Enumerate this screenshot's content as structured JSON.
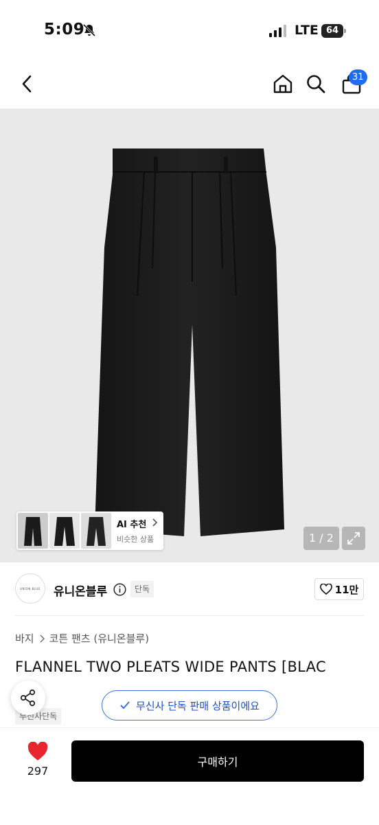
{
  "status_bar": {
    "time": "5:09",
    "network": "LTE",
    "battery": "64"
  },
  "header": {
    "cart_count": "31",
    "icons": [
      "back-icon",
      "home-icon",
      "search-icon",
      "cart-icon"
    ]
  },
  "gallery": {
    "ai_title": "AI 추천",
    "ai_subtitle": "비슷한 상품",
    "page_indicator": "1 / 2",
    "product_color": "#1a1a1a",
    "background_color": "#e9e9e9"
  },
  "brand": {
    "logo_text": "UNION BLUE",
    "name": "유니온블루",
    "tag": "단독",
    "likes": "11만"
  },
  "product": {
    "breadcrumb": [
      "바지",
      "코튼 팬츠 (유니온블루)"
    ],
    "title": "FLANNEL TWO PLEATS WIDE PANTS [BLAC",
    "store_tag": "무신사단독",
    "exclusive_notice": "무신사 단독 판매 상품이에요"
  },
  "bottom_bar": {
    "wish_count": "297",
    "buy_label": "구매하기",
    "heart_color": "#e8242e",
    "accent_color": "#1e6cf0"
  }
}
